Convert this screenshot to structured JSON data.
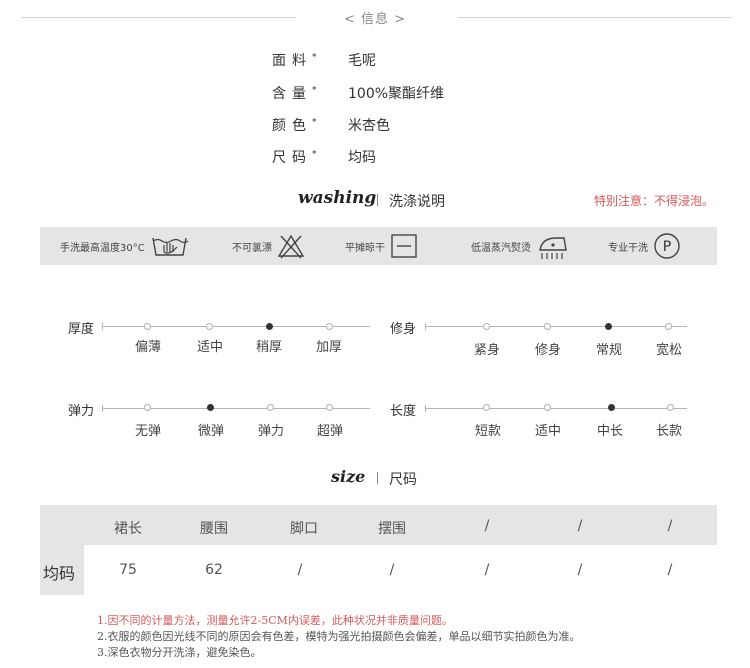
{
  "header": {
    "title": "< 信息 >"
  },
  "info": [
    {
      "label": "面料",
      "value": "毛呢"
    },
    {
      "label": "含量",
      "value": "100%聚酯纤维"
    },
    {
      "label": "颜色",
      "value": "米杏色"
    },
    {
      "label": "尺码",
      "value": "均码"
    }
  ],
  "required_mark": "*",
  "washing": {
    "title_en": "washing",
    "title_cn": "洗涤说明",
    "notice": "特别注意：不得浸泡。",
    "items": [
      {
        "text": "手洗最高温度30°C",
        "icon": "hand-wash-icon"
      },
      {
        "text": "不可氯漂",
        "icon": "no-bleach-icon"
      },
      {
        "text": "平摊晾干",
        "icon": "dry-flat-icon"
      },
      {
        "text": "低温蒸汽熨烫",
        "icon": "low-iron-icon"
      },
      {
        "text": "专业干洗",
        "icon": "dry-clean-icon",
        "glyph": "P"
      }
    ]
  },
  "attributes": [
    {
      "title": "厚度",
      "options": [
        "偏薄",
        "适中",
        "稍厚",
        "加厚"
      ],
      "selected": 2
    },
    {
      "title": "修身",
      "options": [
        "紧身",
        "修身",
        "常规",
        "宽松"
      ],
      "selected": 2
    },
    {
      "title": "弹力",
      "options": [
        "无弹",
        "微弹",
        "弹力",
        "超弹"
      ],
      "selected": 1
    },
    {
      "title": "长度",
      "options": [
        "短款",
        "适中",
        "中长",
        "长款"
      ],
      "selected": 2
    }
  ],
  "size": {
    "title_en": "size",
    "title_cn": "尺码",
    "headers": [
      "裙长",
      "腰围",
      "脚口",
      "摆围",
      "/",
      "/",
      "/"
    ],
    "row_label": "均码",
    "values": [
      "75",
      "62",
      "/",
      "/",
      "/",
      "/",
      "/"
    ]
  },
  "notes": [
    "1.因不同的计量方法，测量允许2-5CM内误差，此种状况并非质量问题。",
    "2.衣服的颜色因光线不同的原因会有色差，模特为强光拍摄颜色会偏差，单品以细节实拍颜色为准。",
    "3.深色衣物分开洗涤，避免染色。"
  ],
  "colors": {
    "notice": "#d35a5a",
    "note1": "#d35a5a",
    "note": "#555555",
    "strip": "#e5e5e5"
  }
}
